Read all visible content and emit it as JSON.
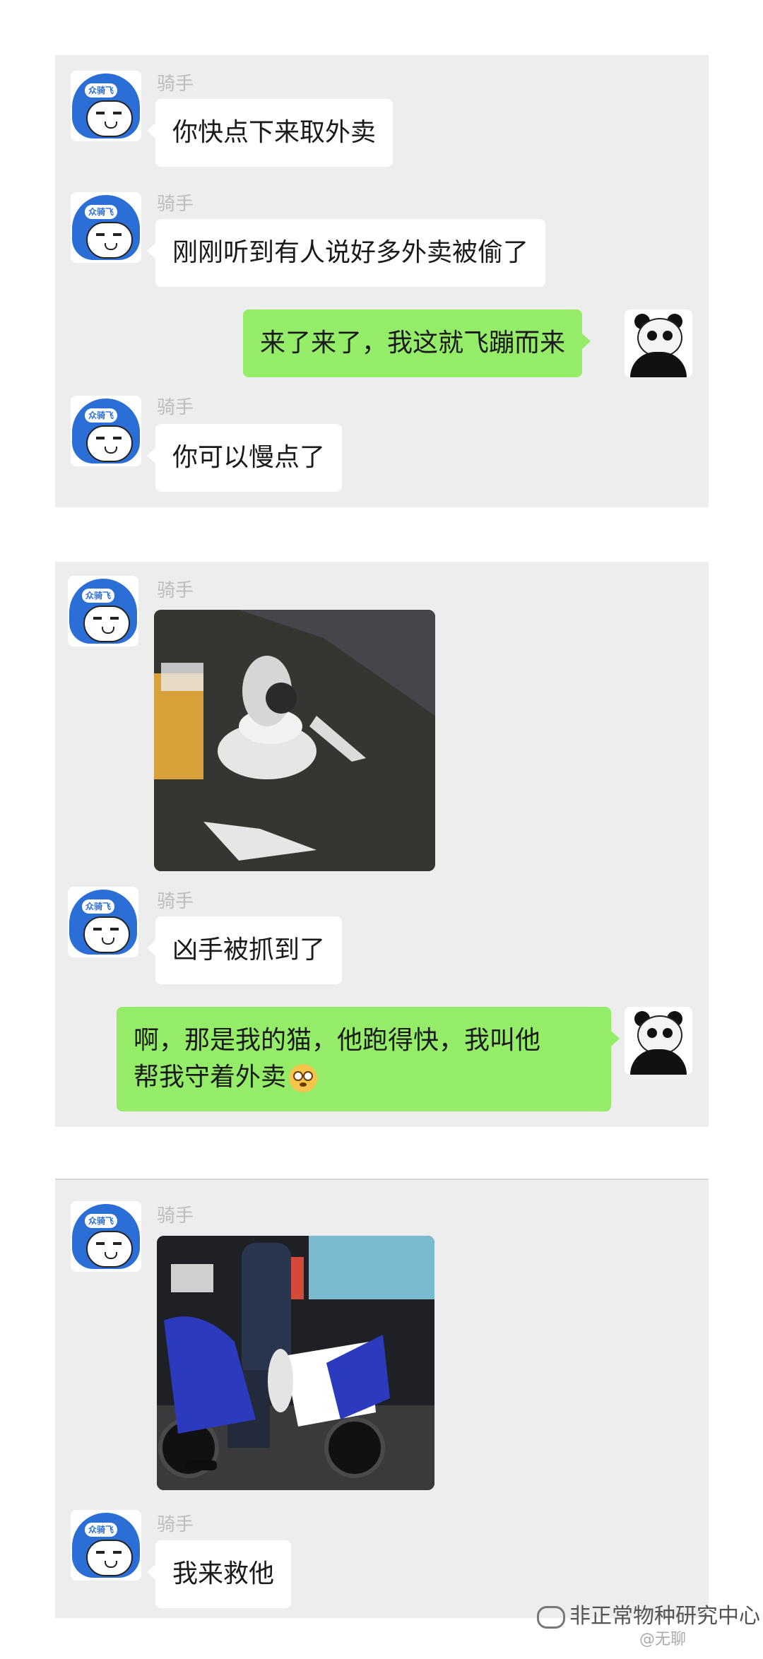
{
  "conversation": {
    "section1": {
      "sender_name": "骑手",
      "messages": [
        {
          "from": "rider",
          "text": "你快点下来取外卖"
        },
        {
          "from": "rider",
          "text": "刚刚听到有人说好多外卖被偷了"
        },
        {
          "from": "me",
          "text": "来了来了，我这就飞蹦而来"
        },
        {
          "from": "rider",
          "text": "你可以慢点了"
        }
      ]
    },
    "section2": {
      "sender_name": "骑手",
      "messages": [
        {
          "from": "rider",
          "type": "image",
          "image_subject": "cat-on-takeout-bag-photo"
        },
        {
          "from": "rider",
          "text": "凶手被抓到了"
        },
        {
          "from": "me",
          "text_line1": "啊，那是我的猫，他跑得快，我叫他",
          "text_line2": "帮我守着外卖"
        }
      ]
    },
    "section3": {
      "sender_name": "骑手",
      "messages": [
        {
          "from": "rider",
          "type": "image",
          "image_subject": "police-officer-on-scooter-holding-cat-photo"
        },
        {
          "from": "rider",
          "text": "我来救他"
        }
      ]
    }
  },
  "avatar": {
    "rider_icon": "helmet-avatar-icon",
    "rider_helmet_text": "众骑飞",
    "me_icon": "panda-meme-avatar-icon"
  },
  "watermark": {
    "text": "非正常物种研究中心",
    "sub_text": "@无聊"
  },
  "colors": {
    "panel_bg": "#ededed",
    "green_bubble": "#95ec69",
    "white_bubble": "#ffffff",
    "helmet_blue": "#2b6fd6"
  }
}
